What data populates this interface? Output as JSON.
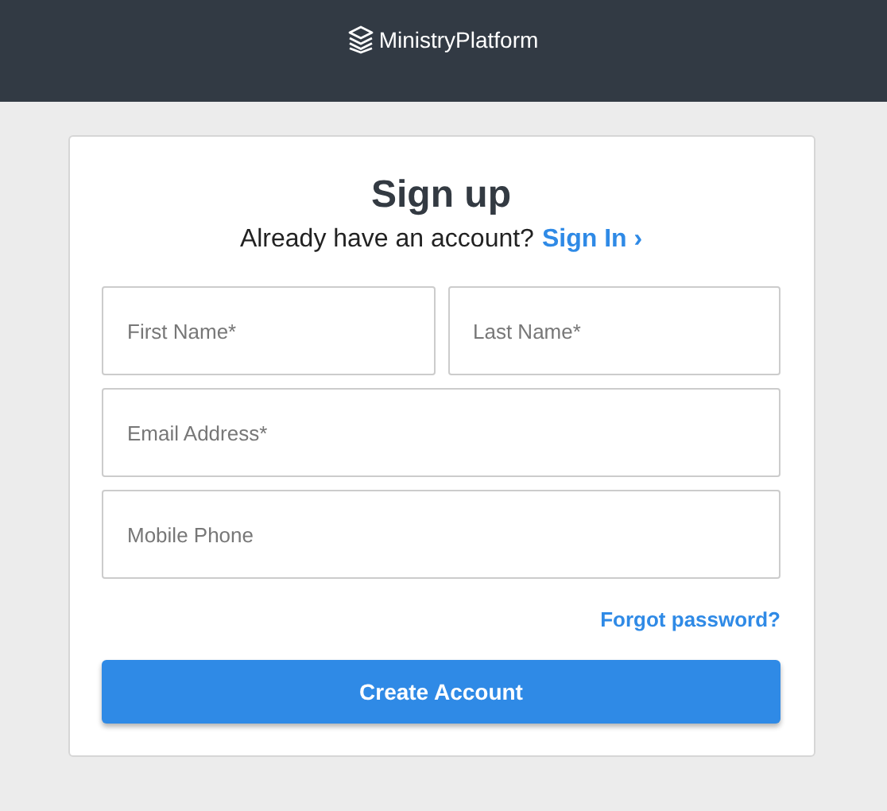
{
  "header": {
    "logo_text": "MinistryPlatform"
  },
  "form": {
    "title": "Sign up",
    "prompt": "Already have an account?",
    "sign_in_link": "Sign In ›",
    "field_rows": [
      [
        {
          "placeholder": "First Name*"
        },
        {
          "placeholder": "Last Name*"
        }
      ],
      [
        {
          "placeholder": "Email Address*"
        }
      ],
      [
        {
          "placeholder": "Mobile Phone"
        }
      ]
    ],
    "forgot_link": "Forgot password?",
    "submit_button": "Create Account"
  }
}
